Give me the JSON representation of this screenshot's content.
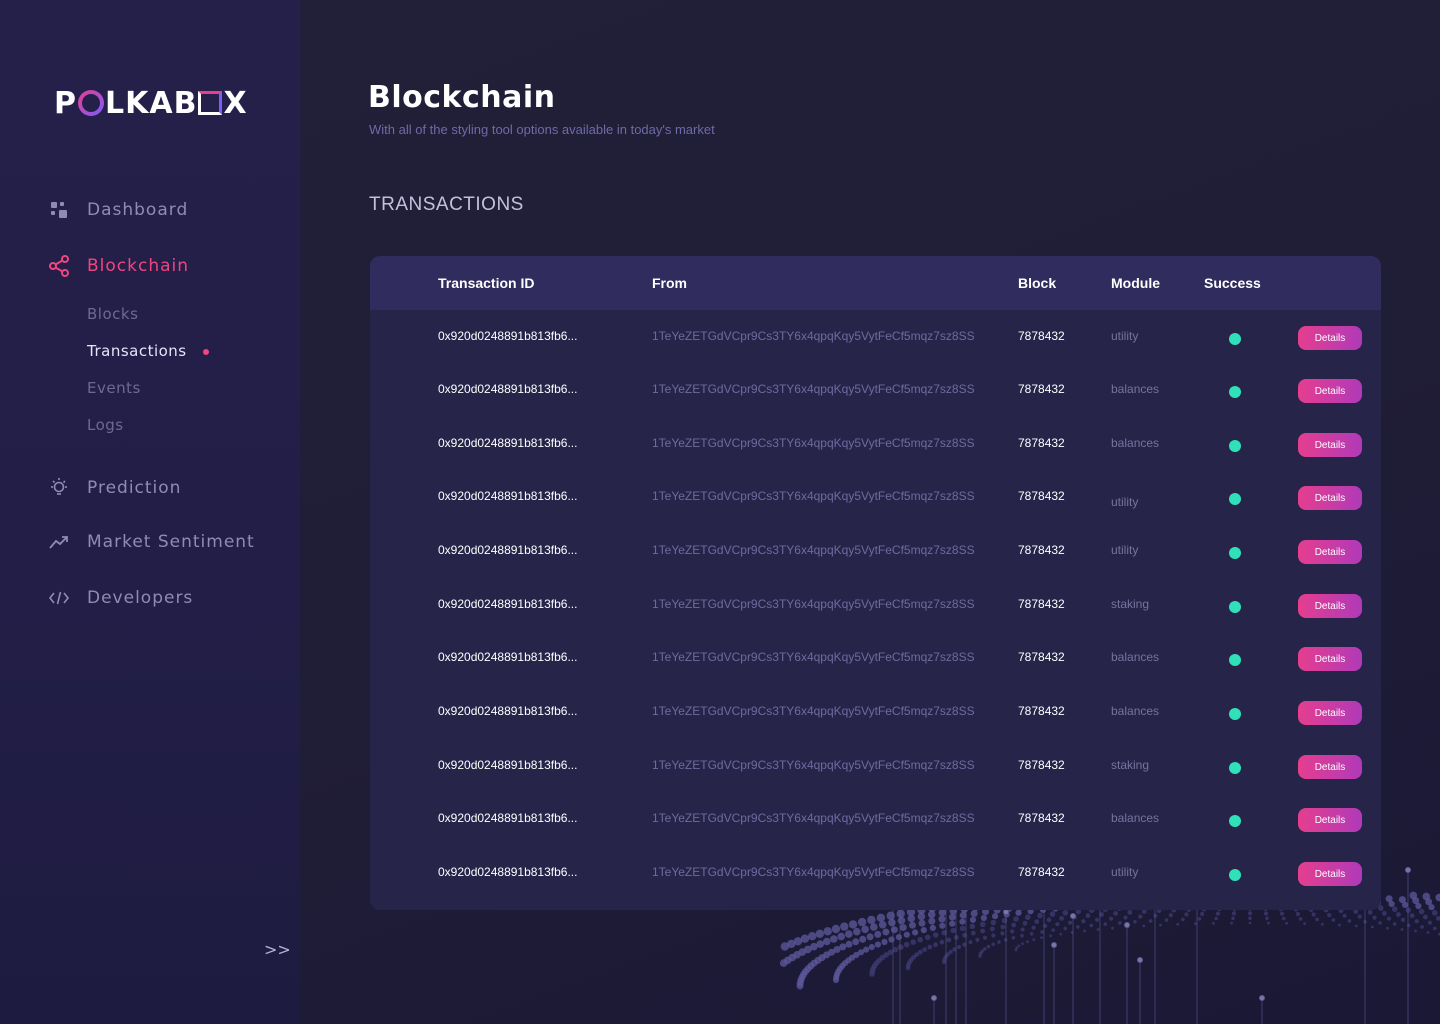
{
  "brand": {
    "logo_text": "POLKABOX",
    "logo_prefix": "P",
    "logo_mid": "LKAB",
    "logo_suffix": "X"
  },
  "sidebar": {
    "items": [
      {
        "label": "Dashboard",
        "icon": "grid-icon"
      },
      {
        "label": "Blockchain",
        "icon": "share-nodes-icon",
        "active": true
      },
      {
        "label": "Prediction",
        "icon": "lightbulb-icon"
      },
      {
        "label": "Market Sentiment",
        "icon": "trend-up-icon"
      },
      {
        "label": "Developers",
        "icon": "code-icon"
      }
    ],
    "sub_items": [
      {
        "label": "Blocks"
      },
      {
        "label": "Transactions",
        "active": true
      },
      {
        "label": "Events"
      },
      {
        "label": "Logs"
      }
    ],
    "collapse_label": ">>"
  },
  "page": {
    "title": "Blockchain",
    "subtitle": "With all of the styling tool options available in today's market",
    "section_title": "TRANSACTIONS"
  },
  "table": {
    "columns": [
      "Transaction ID",
      "From",
      "Block",
      "Module",
      "Success"
    ],
    "rows": [
      {
        "tx": "0x920d0248891b813fb6...",
        "from": "1TeYeZETGdVCpr9Cs3TY6x4qpqKqy5VytFeCf5mqz7sz8SS",
        "block": "7878432",
        "module": "utility",
        "success": true,
        "action": "Details"
      },
      {
        "tx": "0x920d0248891b813fb6...",
        "from": "1TeYeZETGdVCpr9Cs3TY6x4qpqKqy5VytFeCf5mqz7sz8SS",
        "block": "7878432",
        "module": "balances",
        "success": true,
        "action": "Details"
      },
      {
        "tx": "0x920d0248891b813fb6...",
        "from": "1TeYeZETGdVCpr9Cs3TY6x4qpqKqy5VytFeCf5mqz7sz8SS",
        "block": "7878432",
        "module": "balances",
        "success": true,
        "action": "Details"
      },
      {
        "tx": "0x920d0248891b813fb6...",
        "from": "1TeYeZETGdVCpr9Cs3TY6x4qpqKqy5VytFeCf5mqz7sz8SS",
        "block": "7878432",
        "module": "utility",
        "success": true,
        "action": "Details"
      },
      {
        "tx": "0x920d0248891b813fb6...",
        "from": "1TeYeZETGdVCpr9Cs3TY6x4qpqKqy5VytFeCf5mqz7sz8SS",
        "block": "7878432",
        "module": "utility",
        "success": true,
        "action": "Details"
      },
      {
        "tx": "0x920d0248891b813fb6...",
        "from": "1TeYeZETGdVCpr9Cs3TY6x4qpqKqy5VytFeCf5mqz7sz8SS",
        "block": "7878432",
        "module": "staking",
        "success": true,
        "action": "Details"
      },
      {
        "tx": "0x920d0248891b813fb6...",
        "from": "1TeYeZETGdVCpr9Cs3TY6x4qpqKqy5VytFeCf5mqz7sz8SS",
        "block": "7878432",
        "module": "balances",
        "success": true,
        "action": "Details"
      },
      {
        "tx": "0x920d0248891b813fb6...",
        "from": "1TeYeZETGdVCpr9Cs3TY6x4qpqKqy5VytFeCf5mqz7sz8SS",
        "block": "7878432",
        "module": "balances",
        "success": true,
        "action": "Details"
      },
      {
        "tx": "0x920d0248891b813fb6...",
        "from": "1TeYeZETGdVCpr9Cs3TY6x4qpqKqy5VytFeCf5mqz7sz8SS",
        "block": "7878432",
        "module": "staking",
        "success": true,
        "action": "Details"
      },
      {
        "tx": "0x920d0248891b813fb6...",
        "from": "1TeYeZETGdVCpr9Cs3TY6x4qpqKqy5VytFeCf5mqz7sz8SS",
        "block": "7878432",
        "module": "balances",
        "success": true,
        "action": "Details"
      },
      {
        "tx": "0x920d0248891b813fb6...",
        "from": "1TeYeZETGdVCpr9Cs3TY6x4qpqKqy5VytFeCf5mqz7sz8SS",
        "block": "7878432",
        "module": "utility",
        "success": true,
        "action": "Details"
      }
    ]
  },
  "colors": {
    "accent": "#f0457f",
    "success": "#2fe0b9",
    "button_from": "#e53e8f",
    "button_to": "#b03ab8"
  }
}
